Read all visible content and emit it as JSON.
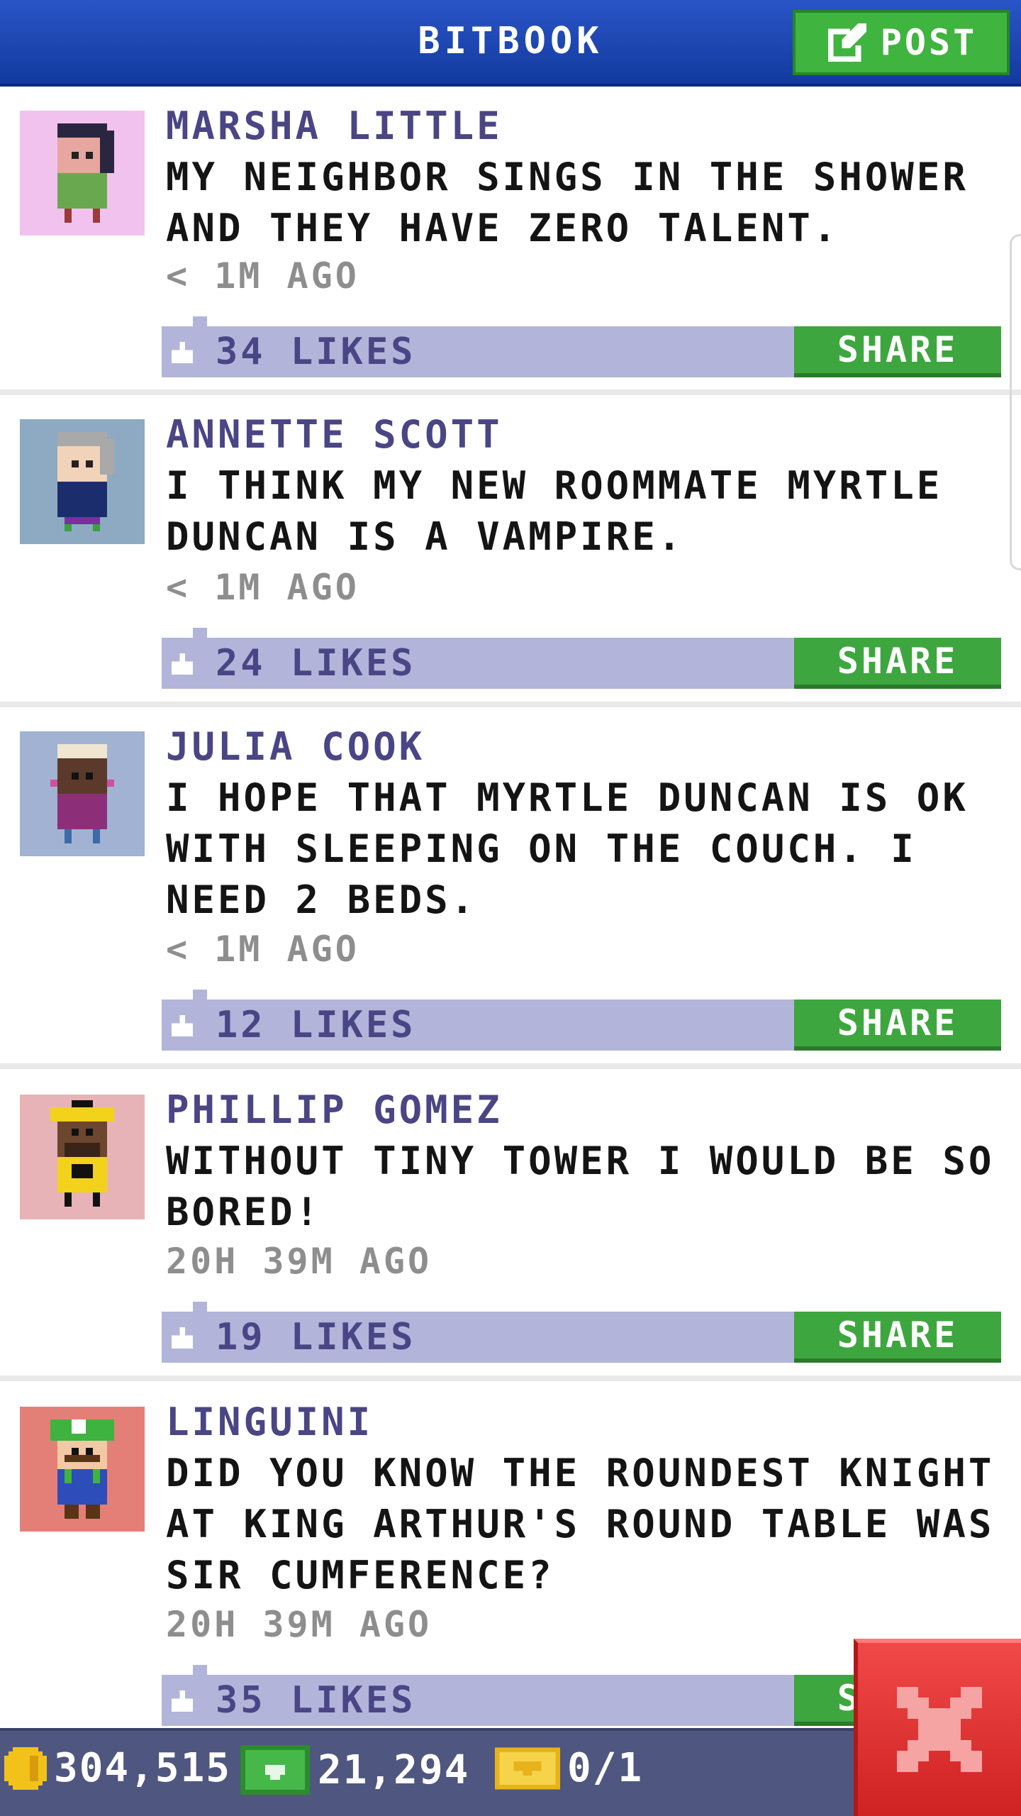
{
  "header": {
    "title": "BITBOOK",
    "post_label": "POST"
  },
  "posts": [
    {
      "name": "MARSHA LITTLE",
      "text": "MY NEIGHBOR SINGS IN THE SHOWER AND THEY HAVE ZERO TALENT.",
      "time": "< 1M AGO",
      "likes": "34 LIKES",
      "share": "SHARE"
    },
    {
      "name": "ANNETTE SCOTT",
      "text": "I THINK MY NEW ROOMMATE MYRTLE DUNCAN IS A VAMPIRE.",
      "time": "< 1M AGO",
      "likes": "24 LIKES",
      "share": "SHARE"
    },
    {
      "name": "JULIA COOK",
      "text": "I HOPE THAT MYRTLE DUNCAN IS OK WITH SLEEPING ON THE COUCH. I NEED 2 BEDS.",
      "time": "< 1M AGO",
      "likes": "12 LIKES",
      "share": "SHARE"
    },
    {
      "name": "PHILLIP GOMEZ",
      "text": "WITHOUT TINY TOWER I WOULD BE SO BORED!",
      "time": "20H 39M AGO",
      "likes": "19 LIKES",
      "share": "SHARE"
    },
    {
      "name": "LINGUINI",
      "text": "DID YOU KNOW THE ROUNDEST KNIGHT AT KING ARTHUR'S ROUND TABLE WAS SIR CUMFERENCE?",
      "time": "20H 39M AGO",
      "likes": "35 LIKES",
      "share": "SHARE"
    }
  ],
  "footer": {
    "coins": "304,515",
    "bux": "21,294",
    "tickets": "0/1"
  },
  "colors": {
    "header_blue": "#1f48b8",
    "share_green": "#3ea63e",
    "like_bar": "#b2b5d9",
    "close_red": "#e03434"
  }
}
